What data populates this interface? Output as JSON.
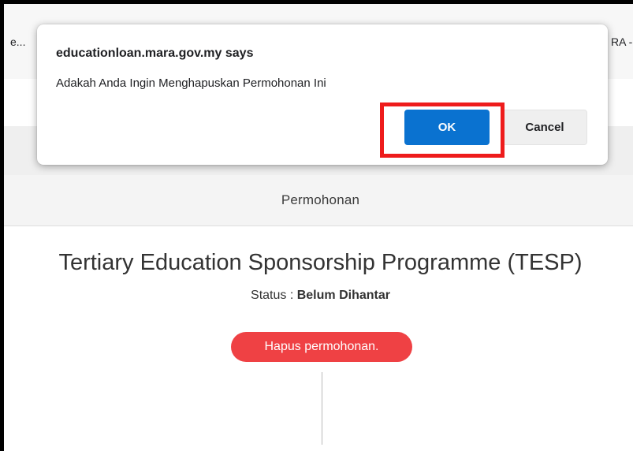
{
  "browser": {
    "tab_left": "e...",
    "tab_right": "RA -"
  },
  "page": {
    "nav_label": "Permohonan",
    "heading": "Tertiary Education Sponsorship Programme (TESP)",
    "status_label": "Status : ",
    "status_value": "Belum Dihantar",
    "delete_button": "Hapus permohonan."
  },
  "dialog": {
    "title": "educationloan.mara.gov.my says",
    "message": "Adakah Anda Ingin Menghapuskan Permohonan Ini",
    "ok_label": "OK",
    "cancel_label": "Cancel"
  },
  "colors": {
    "ok_button": "#0a72d0",
    "highlight_box": "#ee1c1c",
    "delete_pill": "#ef4144"
  }
}
